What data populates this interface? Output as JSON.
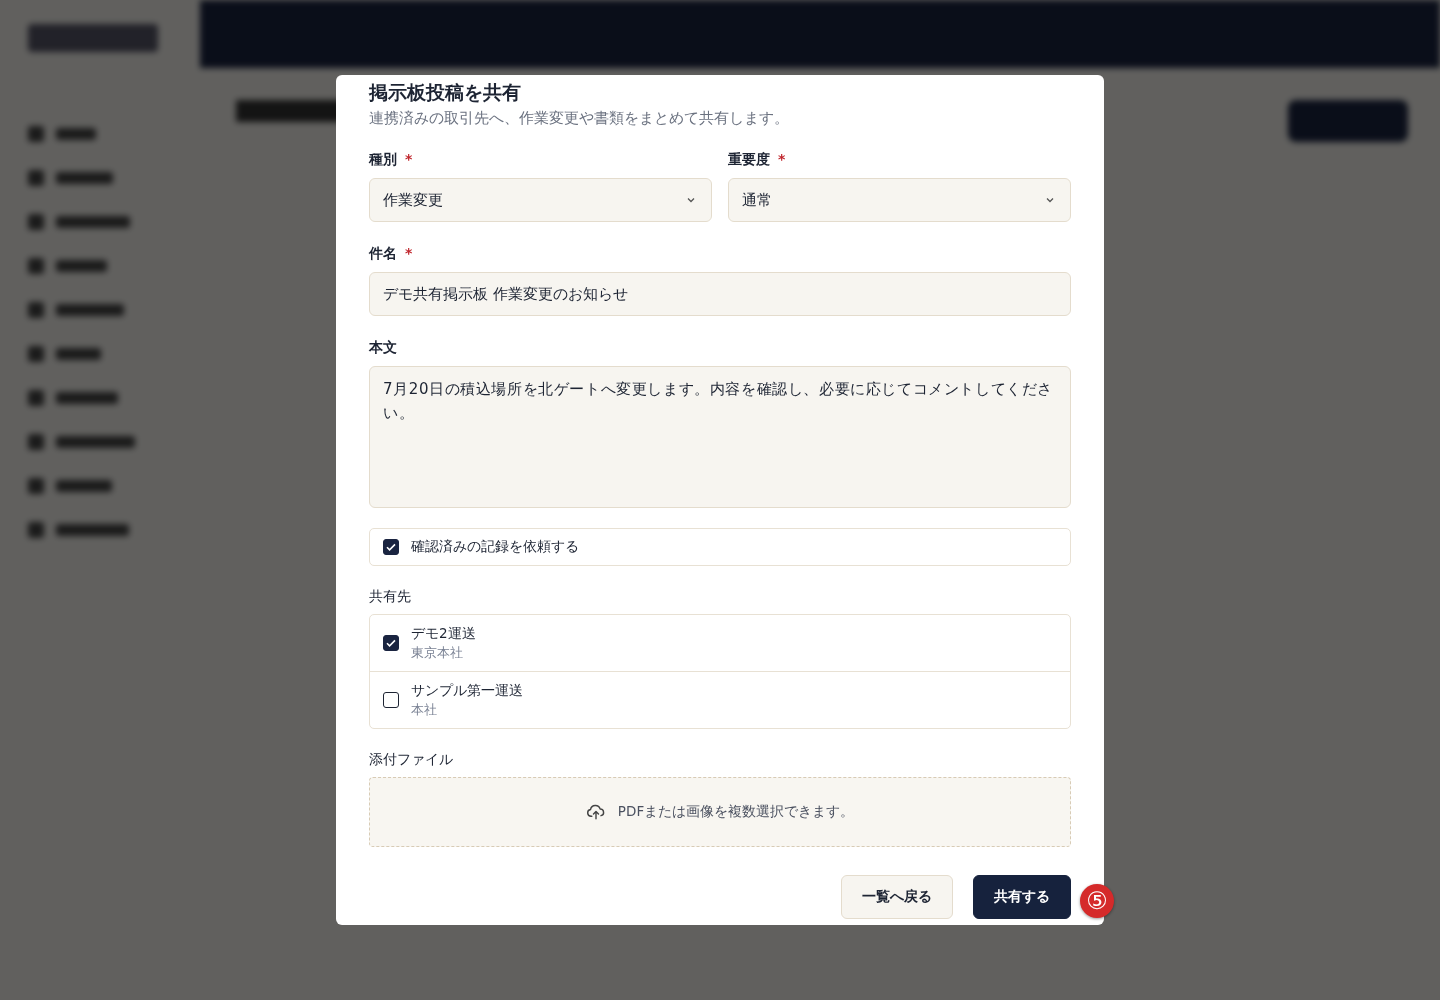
{
  "dialog": {
    "title": "掲示板投稿を共有",
    "description": "連携済みの取引先へ、作業変更や書類をまとめて共有します。",
    "fields": [
      {
        "kind": "select",
        "label": "種別",
        "required_mark": "*",
        "value": "作業変更"
      },
      {
        "kind": "select",
        "label": "重要度",
        "required_mark": "*",
        "value": "通常"
      },
      {
        "kind": "input",
        "label": "件名",
        "required_mark": "*",
        "value": "デモ共有掲示板 作業変更のお知らせ"
      },
      {
        "kind": "textarea",
        "label": "本文",
        "value": "7月20日の積込場所を北ゲートへ変更します。内容を確認し、必要に応じてコメントしてください。"
      }
    ],
    "confirm_option": {
      "label": "確認済みの記録を依頼する",
      "checked": true
    },
    "recipients_label": "共有先",
    "recipients": [
      {
        "name": "デモ2運送",
        "branch": "東京本社",
        "checked": true
      },
      {
        "name": "サンプル第一運送",
        "branch": "本社",
        "checked": false
      }
    ],
    "attachments_label": "添付ファイル",
    "dropzone_text": "PDFまたは画像を複数選択できます。",
    "buttons": [
      {
        "kind": "secondary",
        "label": "一覧へ戻る"
      },
      {
        "kind": "primary",
        "label": "共有する"
      }
    ],
    "step_marker": "⑤"
  }
}
